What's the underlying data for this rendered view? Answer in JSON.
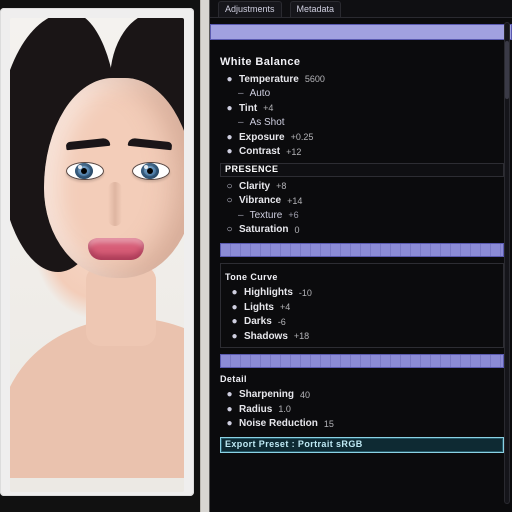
{
  "tabs": {
    "a": "Adjustments",
    "b": "Metadata"
  },
  "section1": {
    "title": "White Balance",
    "i0": {
      "label": "Temperature",
      "value": "5600"
    },
    "i1": {
      "label": "Tint",
      "value": "+4"
    },
    "i2": {
      "label": "Exposure",
      "value": "+0.25"
    },
    "i3": {
      "label": "Contrast",
      "value": "+12"
    },
    "sub1": {
      "dash": "–",
      "label": "Auto"
    },
    "sub2": {
      "dash": "–",
      "label": "As Shot"
    }
  },
  "strip1": {
    "label": "PRESENCE"
  },
  "section2": {
    "i0": {
      "label": "Clarity",
      "value": "+8"
    },
    "i1": {
      "label": "Vibrance",
      "value": "+14"
    },
    "i2": {
      "label": "Saturation",
      "value": "0"
    },
    "sub": {
      "dash": "–",
      "label": "Texture",
      "value": "+6"
    }
  },
  "section3": {
    "title": "Tone Curve",
    "i0": {
      "label": "Highlights",
      "value": "-10"
    },
    "i1": {
      "label": "Lights",
      "value": "+4"
    },
    "i2": {
      "label": "Darks",
      "value": "-6"
    },
    "i3": {
      "label": "Shadows",
      "value": "+18"
    }
  },
  "section4": {
    "title": "Detail",
    "i0": {
      "label": "Sharpening",
      "value": "40"
    },
    "i1": {
      "label": "Radius",
      "value": "1.0"
    },
    "i2": {
      "label": "Noise Reduction",
      "value": "15"
    }
  },
  "selected": {
    "text": "Export Preset : Portrait sRGB"
  }
}
